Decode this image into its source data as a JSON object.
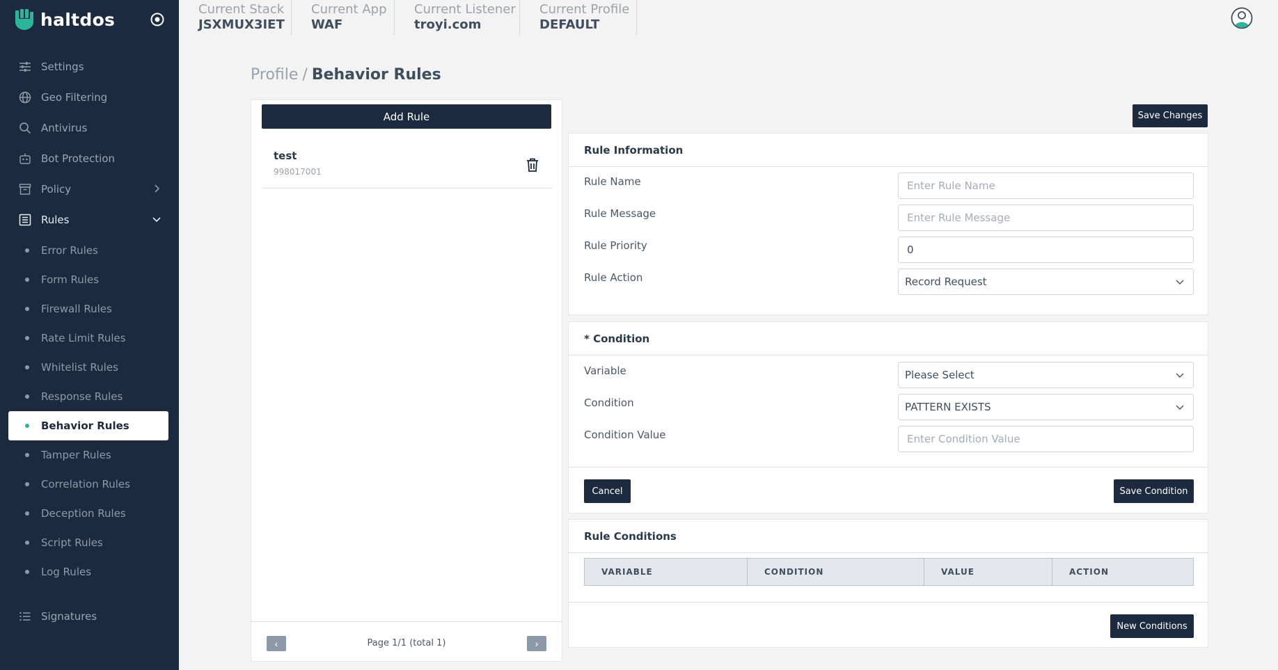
{
  "brand": {
    "name": "haltdos",
    "accent": "#2bb59a",
    "sidebar_bg": "#1b2a3f"
  },
  "sidebar": {
    "items": [
      {
        "label": "Settings",
        "icon": "sliders-icon"
      },
      {
        "label": "Geo Filtering",
        "icon": "globe-icon"
      },
      {
        "label": "Antivirus",
        "icon": "search-icon"
      },
      {
        "label": "Bot Protection",
        "icon": "robot-icon"
      },
      {
        "label": "Policy",
        "icon": "archive-icon"
      },
      {
        "label": "Rules",
        "icon": "list-icon"
      },
      {
        "label": "Signatures",
        "icon": "bullet-list-icon"
      }
    ],
    "rules_children": [
      "Error Rules",
      "Form Rules",
      "Firewall Rules",
      "Rate Limit Rules",
      "Whitelist Rules",
      "Response Rules",
      "Behavior Rules",
      "Tamper Rules",
      "Correlation Rules",
      "Deception Rules",
      "Script Rules",
      "Log Rules"
    ],
    "active_child": "Behavior Rules"
  },
  "topbar": {
    "stack": {
      "label": "Current Stack",
      "value": "JSXMUX3IET"
    },
    "app": {
      "label": "Current App",
      "value": "WAF"
    },
    "listener": {
      "label": "Current Listener",
      "value": "troyi.com"
    },
    "profile": {
      "label": "Current Profile",
      "value": "DEFAULT"
    }
  },
  "breadcrumb": {
    "parent": "Profile",
    "separator": "/",
    "current": "Behavior Rules"
  },
  "rules_panel": {
    "add_label": "Add Rule",
    "rules": [
      {
        "name": "test",
        "id": "998017001"
      }
    ],
    "pager": {
      "prev": "‹",
      "next": "›",
      "text": "Page 1/1 (total 1)"
    }
  },
  "form": {
    "save_changes": "Save Changes",
    "rule_info": {
      "title": "Rule Information",
      "name_label": "Rule Name",
      "name_placeholder": "Enter Rule Name",
      "message_label": "Rule Message",
      "message_placeholder": "Enter Rule Message",
      "priority_label": "Rule Priority",
      "priority_value": "0",
      "action_label": "Rule Action",
      "action_value": "Record Request"
    },
    "condition": {
      "title": "* Condition",
      "variable_label": "Variable",
      "variable_value": "Please Select",
      "condition_label": "Condition",
      "condition_value": "PATTERN EXISTS",
      "value_label": "Condition Value",
      "value_placeholder": "Enter Condition Value",
      "cancel": "Cancel",
      "save": "Save Condition"
    },
    "rule_conditions": {
      "title": "Rule Conditions",
      "columns": [
        "VARIABLE",
        "CONDITION",
        "VALUE",
        "ACTION"
      ],
      "new_label": "New Conditions"
    }
  }
}
